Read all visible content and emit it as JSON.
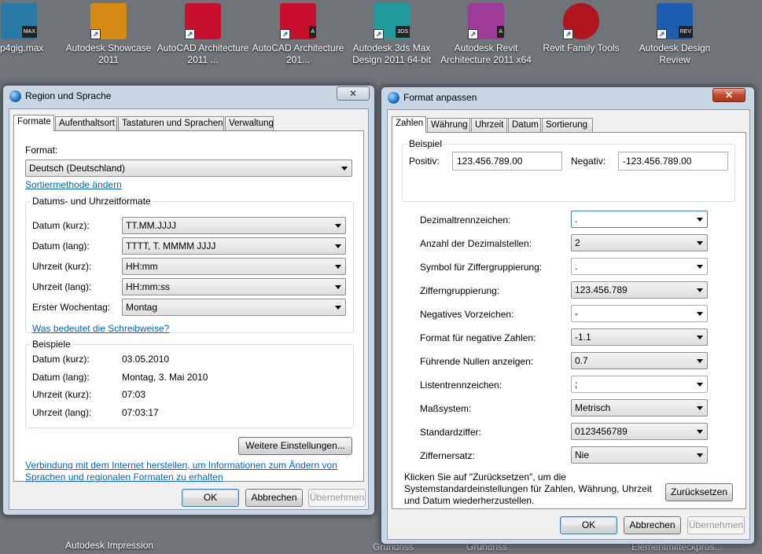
{
  "desktop": {
    "icons": [
      {
        "label": "p4gig.max",
        "tag": "MAX",
        "color": "#2a7aa8"
      },
      {
        "label": "Autodesk Showcase 2011",
        "tag": "",
        "color": "#d58b12"
      },
      {
        "label": "AutoCAD Architecture 2011 ...",
        "tag": "",
        "color": "#c8102e"
      },
      {
        "label": "AutoCAD Architecture 201...",
        "tag": "A",
        "color": "#c8102e"
      },
      {
        "label": "Autodesk 3ds Max Design 2011 64-bit",
        "tag": "3DS",
        "color": "#1f9c9c"
      },
      {
        "label": "Autodesk Revit Architecture 2011 x64",
        "tag": "A",
        "color": "#a03a9a"
      },
      {
        "label": "Revit Family Tools",
        "tag": "",
        "color": "#b0141c"
      },
      {
        "label": "Autodesk Design Review",
        "tag": "REV",
        "color": "#1c5db0"
      }
    ],
    "bottom_labels": [
      "Autodesk Impression",
      "Grundriss",
      "Grundriss",
      "Elementmitteckpros..."
    ]
  },
  "region": {
    "title": "Region und Sprache",
    "close": "✕",
    "tabs": [
      "Formate",
      "Aufenthaltsort",
      "Tastaturen und Sprachen",
      "Verwaltung"
    ],
    "format_label": "Format:",
    "format_value": "Deutsch (Deutschland)",
    "sort_link": "Sortiermethode ändern",
    "dt_group": "Datums- und Uhrzeitformate",
    "dt_rows": [
      {
        "label": "Datum (kurz):",
        "value": "TT.MM.JJJJ"
      },
      {
        "label": "Datum (lang):",
        "value": "TTTT, T. MMMM JJJJ"
      },
      {
        "label": "Uhrzeit (kurz):",
        "value": "HH:mm"
      },
      {
        "label": "Uhrzeit (lang):",
        "value": "HH:mm:ss"
      },
      {
        "label": "Erster Wochentag:",
        "value": "Montag"
      }
    ],
    "notation_link": "Was bedeutet die Schreibweise?",
    "examples_group": "Beispiele",
    "examples": [
      {
        "label": "Datum (kurz):",
        "value": "03.05.2010"
      },
      {
        "label": "Datum (lang):",
        "value": "Montag, 3. Mai 2010"
      },
      {
        "label": "Uhrzeit (kurz):",
        "value": "07:03"
      },
      {
        "label": "Uhrzeit (lang):",
        "value": "07:03:17"
      }
    ],
    "more_settings": "Weitere Einstellungen...",
    "internet_link_1": "Verbindung mit dem Internet herstellen, um Informationen zum Ändern von",
    "internet_link_2": "Sprachen und regionalen Formaten zu erhalten",
    "ok": "OK",
    "cancel": "Abbrechen",
    "apply": "Übernehmen"
  },
  "format": {
    "title": "Format anpassen",
    "close": "✕",
    "tabs": [
      "Zahlen",
      "Währung",
      "Uhrzeit",
      "Datum",
      "Sortierung"
    ],
    "example_group": "Beispiel",
    "positive_label": "Positiv:",
    "positive_value": "123.456.789.00",
    "negative_label": "Negativ:",
    "negative_value": "-123.456.789.00",
    "rows": [
      {
        "label": "Dezimaltrennzeichen:",
        "value": "."
      },
      {
        "label": "Anzahl der Dezimalstellen:",
        "value": "2"
      },
      {
        "label": "Symbol für Ziffergruppierung:",
        "value": "."
      },
      {
        "label": "Zifferngruppierung:",
        "value": "123.456.789"
      },
      {
        "label": "Negatives Vorzeichen:",
        "value": "-"
      },
      {
        "label": "Format für negative Zahlen:",
        "value": "-1.1"
      },
      {
        "label": "Führende Nullen anzeigen:",
        "value": "0.7"
      },
      {
        "label": "Listentrennzeichen:",
        "value": ";"
      },
      {
        "label": "Maßsystem:",
        "value": "Metrisch"
      },
      {
        "label": "Standardziffer:",
        "value": "0123456789"
      },
      {
        "label": "Ziffernersatz:",
        "value": "Nie"
      }
    ],
    "reset_text_1": "Klicken Sie auf \"Zurücksetzen\", um die",
    "reset_text_2": "Systemstandardeinstellungen für Zahlen, Währung, Uhrzeit",
    "reset_text_3": "und Datum wiederherzustellen.",
    "reset": "Zurücksetzen",
    "ok": "OK",
    "cancel": "Abbrechen",
    "apply": "Übernehmen"
  }
}
